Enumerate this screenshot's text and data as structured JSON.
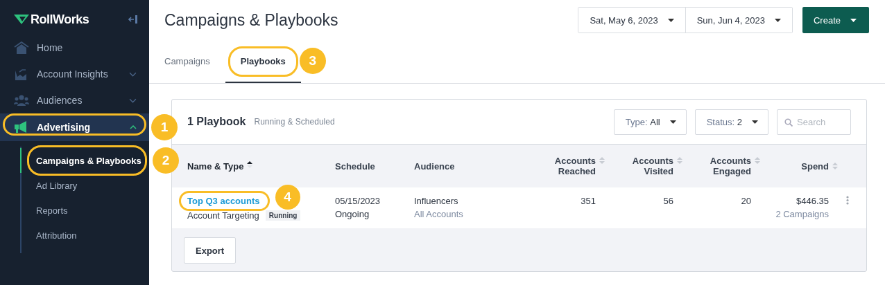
{
  "sidebar": {
    "logo": "RollWorks",
    "items": [
      {
        "label": "Home",
        "selected": false
      },
      {
        "label": "Account Insights",
        "expandable": true,
        "expanded": false,
        "selected": false
      },
      {
        "label": "Audiences",
        "expandable": true,
        "expanded": false,
        "selected": false
      },
      {
        "label": "Advertising",
        "expandable": true,
        "expanded": true,
        "selected": true,
        "callout": "1",
        "children": [
          {
            "label": "Campaigns & Playbooks",
            "selected": true,
            "callout": "2"
          },
          {
            "label": "Ad Library",
            "selected": false
          },
          {
            "label": "Reports",
            "selected": false
          },
          {
            "label": "Attribution",
            "selected": false
          }
        ]
      }
    ]
  },
  "header": {
    "title": "Campaigns & Playbooks",
    "dates": [
      "Sat, May 6, 2023",
      "Sun, Jun 4, 2023"
    ],
    "create": "Create"
  },
  "tabs": [
    {
      "label": "Campaigns",
      "selected": false
    },
    {
      "label": "Playbooks",
      "selected": true,
      "callout": "3"
    }
  ],
  "card": {
    "count": "1 Playbook",
    "subtitle": "Running & Scheduled",
    "filters": [
      {
        "label": "Type:",
        "value": "All"
      },
      {
        "label": "Status:",
        "value": "2"
      }
    ],
    "search": {
      "placeholder": "Search"
    },
    "columns": [
      {
        "label": "Name & Type",
        "sortable": true,
        "sorted": true
      },
      {
        "label": "Schedule"
      },
      {
        "label": "Audience"
      },
      {
        "label": "Accounts Reached",
        "sortable": true,
        "sorted": false
      },
      {
        "label": "Accounts Visited",
        "sortable": true,
        "sorted": false
      },
      {
        "label": "Accounts Engaged",
        "sortable": true,
        "sorted": false
      },
      {
        "label": "Spend",
        "sortable": true,
        "sorted": false
      }
    ],
    "rows": [
      {
        "name": "Top Q3 accounts",
        "callout": "4",
        "type": "Account Targeting",
        "status": "Running",
        "schedule": "05/15/2023",
        "schedule_end": "Ongoing",
        "audience": "Influencers",
        "audience_scope": "All Accounts",
        "reached": "351",
        "visited": "56",
        "engaged": "20",
        "spend": "$446.35",
        "campaigns": "2 Campaigns"
      }
    ],
    "export": "Export"
  }
}
